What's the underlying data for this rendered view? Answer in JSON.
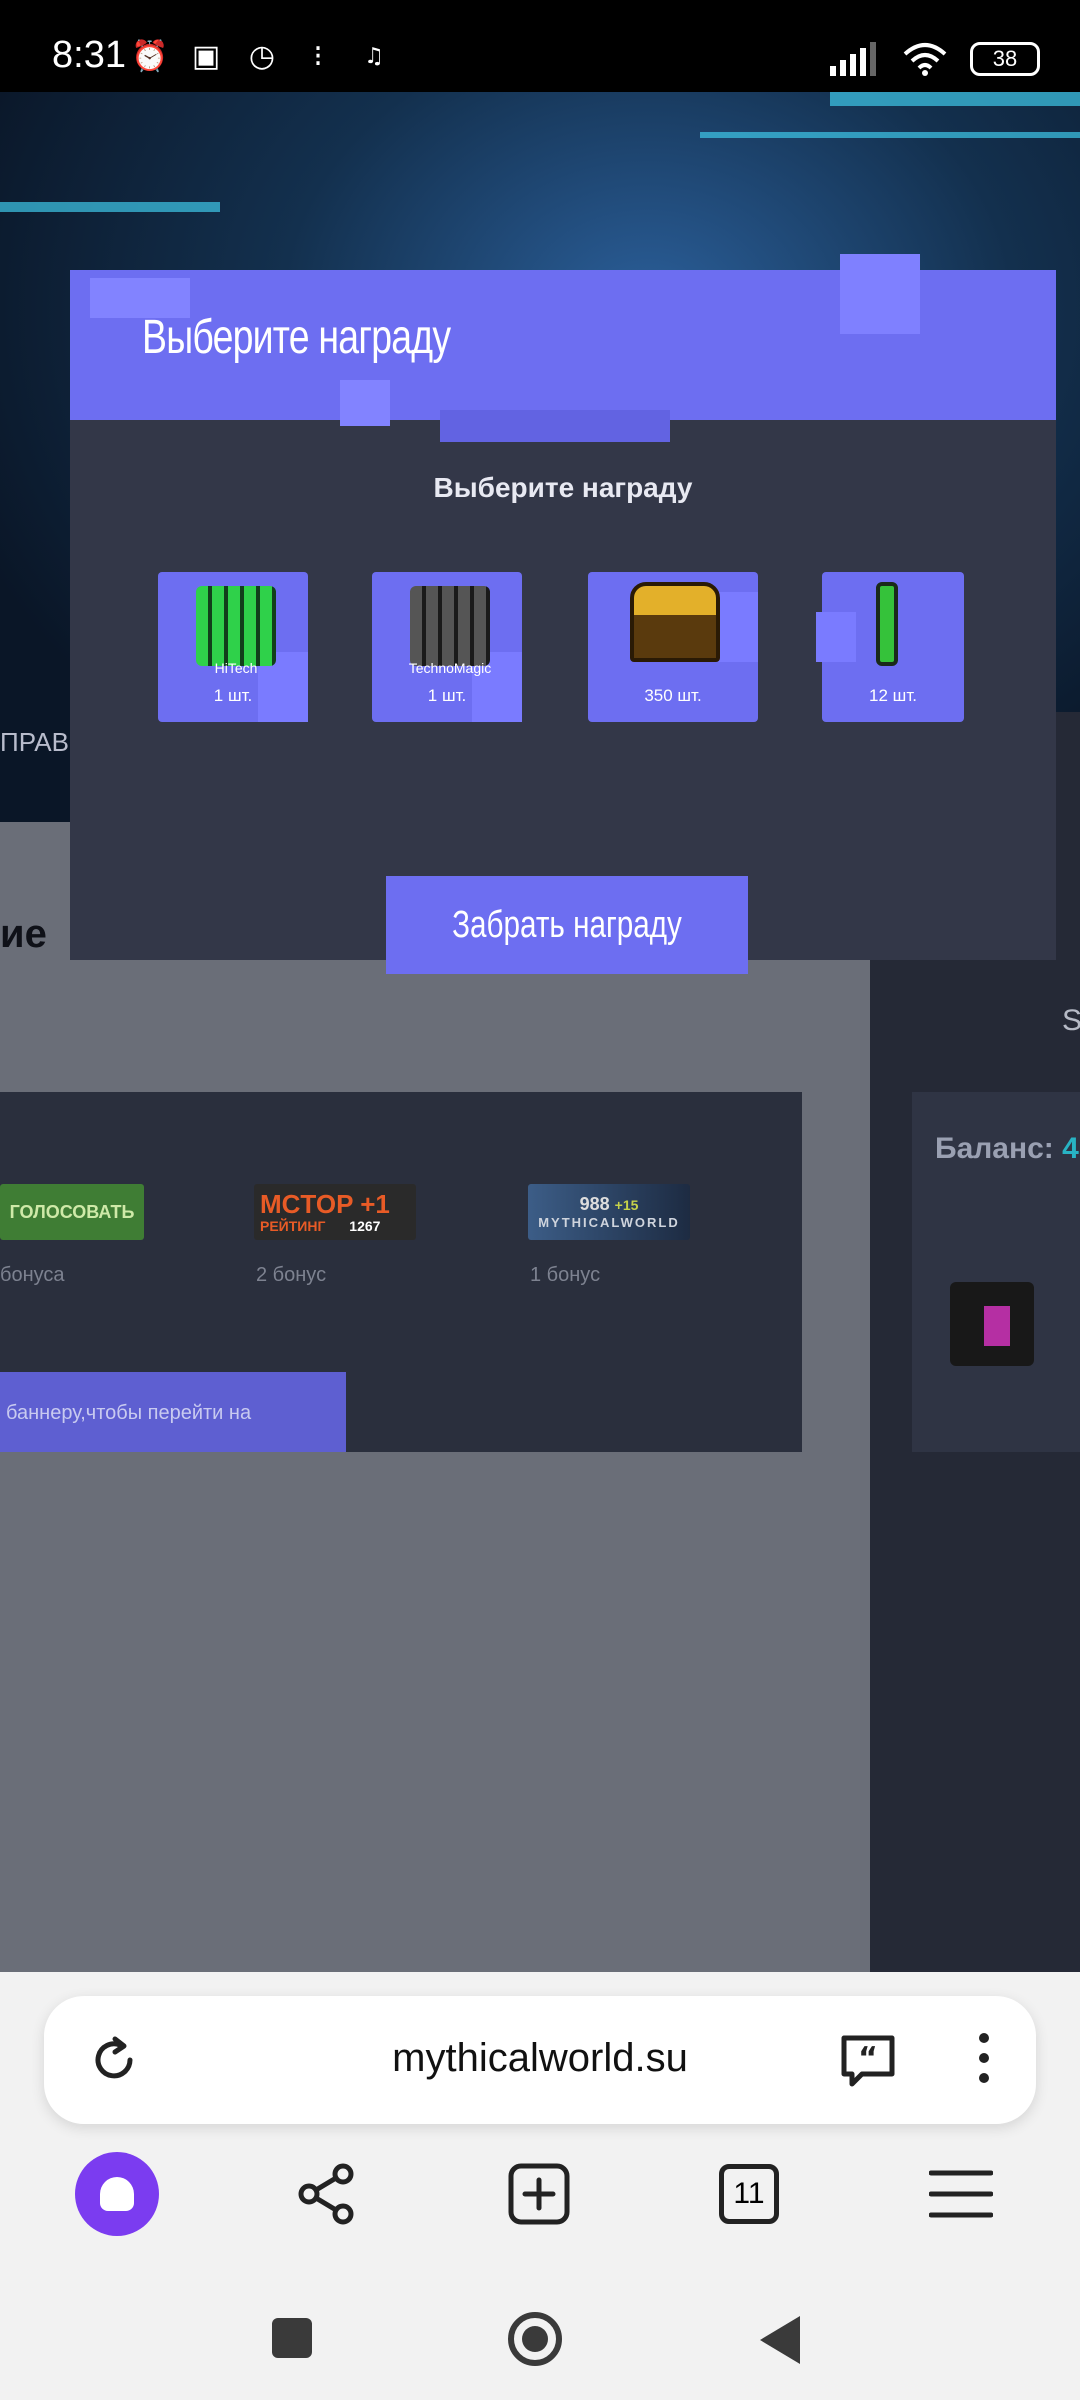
{
  "status_bar": {
    "time": "8:31",
    "battery": "38",
    "icons": [
      "alarm-icon",
      "nfc-icon",
      "clock-icon",
      "steps-icon",
      "music-note-icon",
      "signal-icon",
      "wifi-icon",
      "battery-icon"
    ]
  },
  "page": {
    "hero_partial_text": "ПРАВ",
    "section_title_partial": "ие",
    "right_partial_text": "S",
    "vote_banners": [
      {
        "label": "ГОЛОСОВАТЬ",
        "bonus": "бонуса"
      },
      {
        "label_top": "MCTOP",
        "label_top_plus": "+1",
        "label_bottom": "РЕЙТИНГ",
        "label_count": "1267",
        "bonus": "2 бонус"
      },
      {
        "label_top": "988",
        "label_top_plus": "+15",
        "label_bottom": "MYTHICALWORLD",
        "bonus": "1 бонус"
      }
    ],
    "hint_text": "баннеру,чтобы перейти на",
    "balance_label": "Баланс:",
    "balance_value": "4"
  },
  "modal": {
    "title": "Выберите награду",
    "subtitle": "Выберите награду",
    "rewards": [
      {
        "name": "HiTech",
        "qty": "1 шт.",
        "color": "#2fd14a"
      },
      {
        "name": "TechnoMagic",
        "qty": "1 шт.",
        "color": "#3a3a3a"
      },
      {
        "name": "",
        "qty": "350 шт.",
        "color": "#d59a1c"
      },
      {
        "name": "",
        "qty": "12 шт.",
        "color": "#35c23a"
      }
    ],
    "claim_button": "Забрать награду"
  },
  "browser": {
    "url": "mythicalworld.su",
    "tabs_count": "11",
    "accent": "#7b3cf0"
  }
}
